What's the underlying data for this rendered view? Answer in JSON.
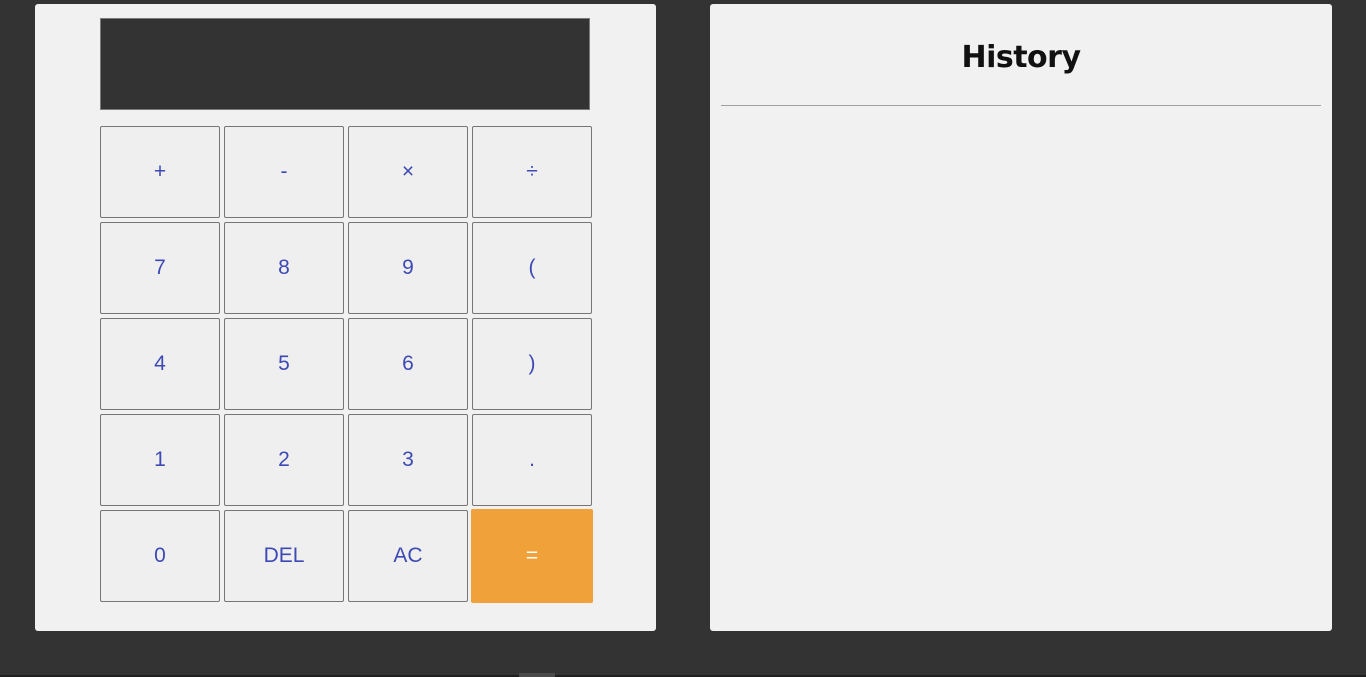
{
  "calculator": {
    "display_value": "",
    "keys": {
      "plus": "+",
      "minus": "-",
      "multiply": "×",
      "divide": "÷",
      "seven": "7",
      "eight": "8",
      "nine": "9",
      "open_paren": "(",
      "four": "4",
      "five": "5",
      "six": "6",
      "close_paren": ")",
      "one": "1",
      "two": "2",
      "three": "3",
      "decimal": ".",
      "zero": "0",
      "delete": "DEL",
      "clear": "AC",
      "equals": "="
    },
    "accent_color": "#f0a13a",
    "key_text_color": "#3d4ab5"
  },
  "history": {
    "title": "History",
    "entries": []
  }
}
